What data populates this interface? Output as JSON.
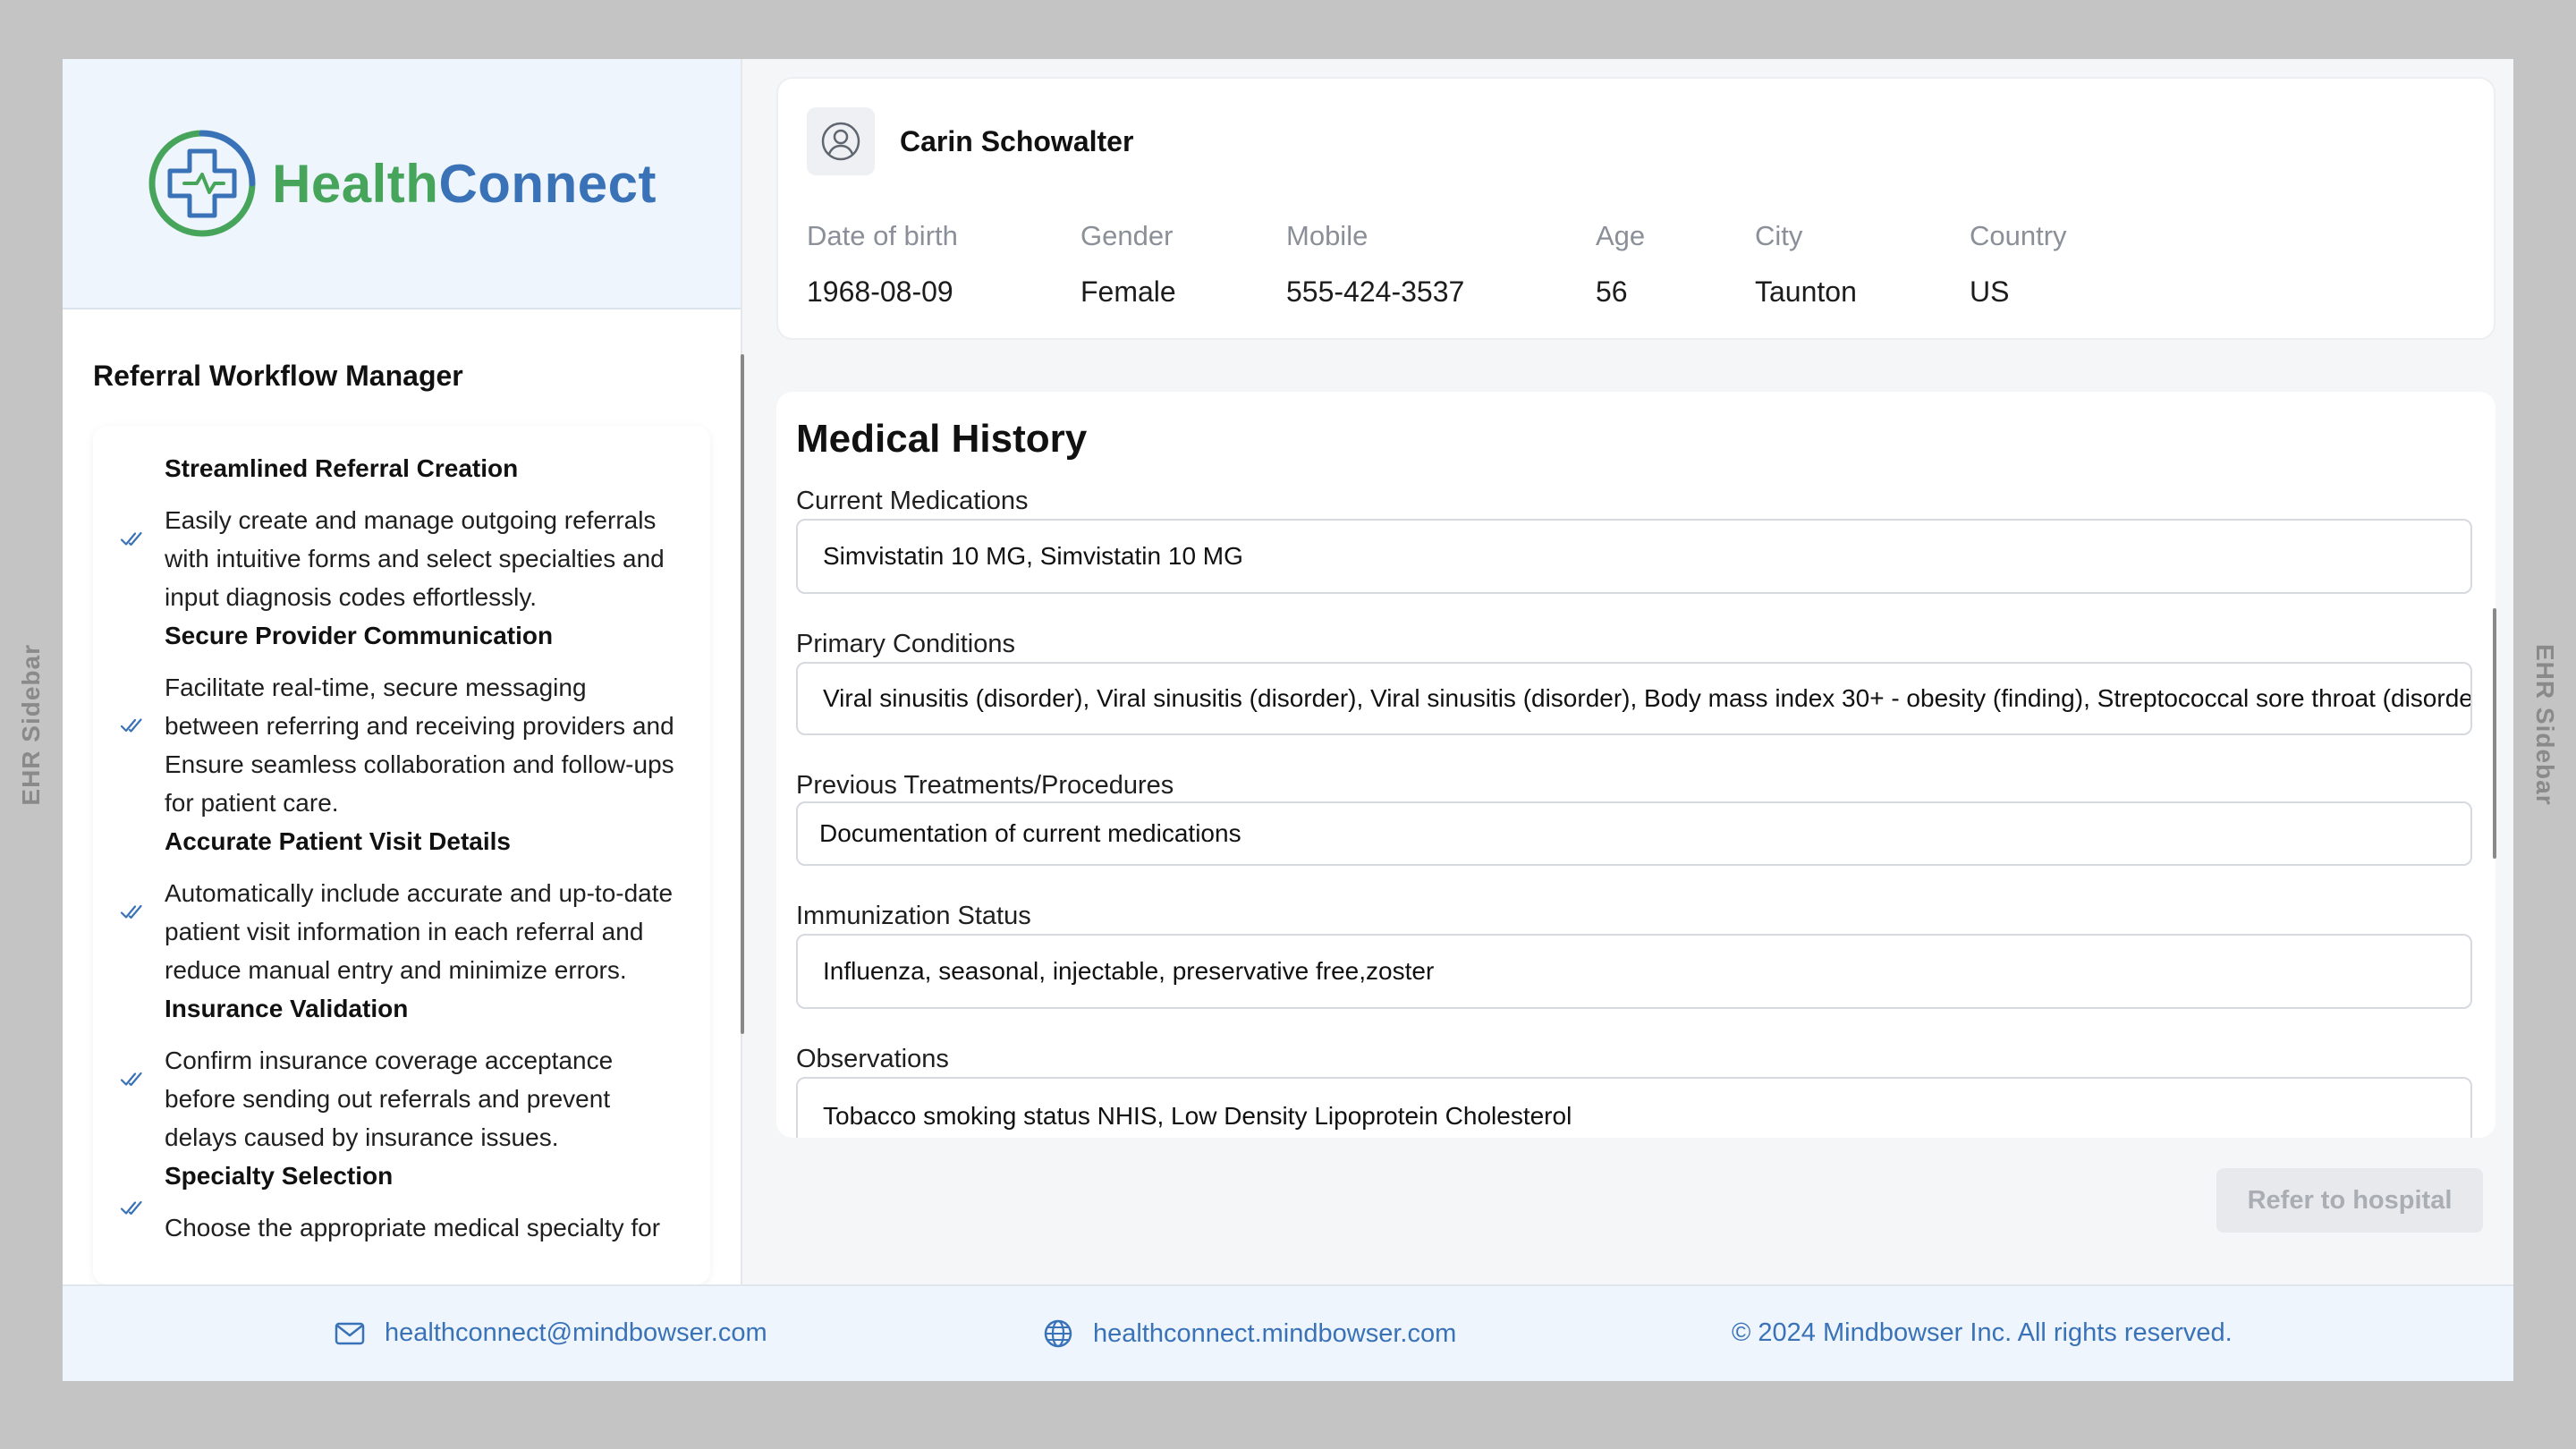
{
  "side_tabs": {
    "left": "EHR Sidebar",
    "right": "EHR Sidebar"
  },
  "brand": {
    "part1": "Health",
    "part2": "Connect",
    "color_green": "#47a55b",
    "color_blue": "#3a72b8"
  },
  "sidebar": {
    "title": "Referral Workflow Manager",
    "features": [
      {
        "title": "Streamlined Referral Creation",
        "desc": "Easily create and manage outgoing referrals with intuitive forms and select specialties and input diagnosis codes effortlessly."
      },
      {
        "title": "Secure Provider Communication",
        "desc": "Facilitate real-time, secure messaging between referring and receiving providers and Ensure seamless collaboration and follow-ups for patient care."
      },
      {
        "title": "Accurate Patient Visit Details",
        "desc": "Automatically include accurate and up-to-date patient visit information in each referral and reduce manual entry and minimize errors."
      },
      {
        "title": "Insurance Validation",
        "desc": "Confirm insurance coverage acceptance before sending out referrals and prevent delays caused by insurance issues."
      },
      {
        "title": "Specialty Selection",
        "desc": "Choose the appropriate medical specialty for"
      }
    ]
  },
  "patient": {
    "name": "Carin Schowalter",
    "fields": [
      {
        "label": "Date of birth",
        "value": "1968-08-09"
      },
      {
        "label": "Gender",
        "value": "Female"
      },
      {
        "label": "Mobile",
        "value": "555-424-3537"
      },
      {
        "label": "Age",
        "value": "56"
      },
      {
        "label": "City",
        "value": "Taunton"
      },
      {
        "label": "Country",
        "value": "US"
      }
    ]
  },
  "history": {
    "title": "Medical History",
    "fields": [
      {
        "label": "Current Medications",
        "value": "Simvistatin 10 MG, Simvistatin 10 MG"
      },
      {
        "label": "Primary Conditions",
        "value": "Viral sinusitis (disorder), Viral sinusitis (disorder), Viral sinusitis (disorder), Body mass index 30+ - obesity (finding), Streptococcal sore throat (disorder)"
      },
      {
        "label": "Previous Treatments/Procedures",
        "value": "Documentation of current medications"
      },
      {
        "label": "Immunization Status",
        "value": "Influenza, seasonal, injectable, preservative free,zoster"
      },
      {
        "label": "Observations",
        "value": "Tobacco smoking status NHIS, Low Density Lipoprotein Cholesterol"
      }
    ]
  },
  "actions": {
    "refer_label": "Refer to hospital"
  },
  "footer": {
    "email": "healthconnect@mindbowser.com",
    "website": "healthconnect.mindbowser.com",
    "copyright": "© 2024 Mindbowser Inc. All rights reserved."
  }
}
